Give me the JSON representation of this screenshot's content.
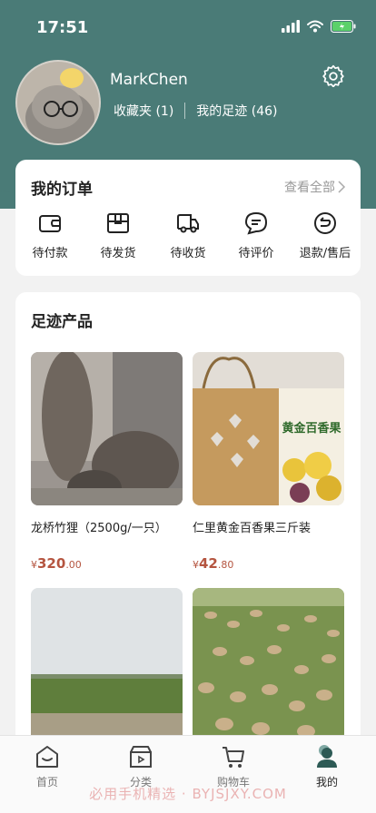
{
  "status": {
    "time": "17:51"
  },
  "profile": {
    "username": "MarkChen",
    "favorites": "收藏夹 (1)",
    "footprints": "我的足迹 (46)"
  },
  "orders": {
    "title": "我的订单",
    "view_all": "查看全部",
    "items": [
      {
        "label": "待付款",
        "icon": "wallet-icon"
      },
      {
        "label": "待发货",
        "icon": "package-icon"
      },
      {
        "label": "待收货",
        "icon": "truck-icon"
      },
      {
        "label": "待评价",
        "icon": "comment-icon"
      },
      {
        "label": "退款/售后",
        "icon": "return-icon"
      }
    ]
  },
  "footprint": {
    "title": "足迹产品",
    "products": [
      {
        "name": "龙桥竹狸（2500g/一只）",
        "currency": "¥",
        "price_int": "320",
        "price_dec": ".00"
      },
      {
        "name": "仁里黄金百香果三斤装",
        "currency": "¥",
        "price_int": "42",
        "price_dec": ".80"
      },
      {
        "name": "",
        "currency": "",
        "price_int": "",
        "price_dec": ""
      },
      {
        "name": "",
        "currency": "",
        "price_int": "",
        "price_dec": ""
      }
    ],
    "box_text": "黄金百香果"
  },
  "tabs": [
    {
      "label": "首页",
      "icon": "home-icon"
    },
    {
      "label": "分类",
      "icon": "category-icon"
    },
    {
      "label": "购物车",
      "icon": "cart-icon"
    },
    {
      "label": "我的",
      "icon": "profile-icon",
      "active": true
    }
  ],
  "watermark": "必用手机精选 · BYJSJXY.COM",
  "colors": {
    "header": "#4a7b77",
    "price": "#b55540",
    "active_tab": "#2d5a55"
  }
}
